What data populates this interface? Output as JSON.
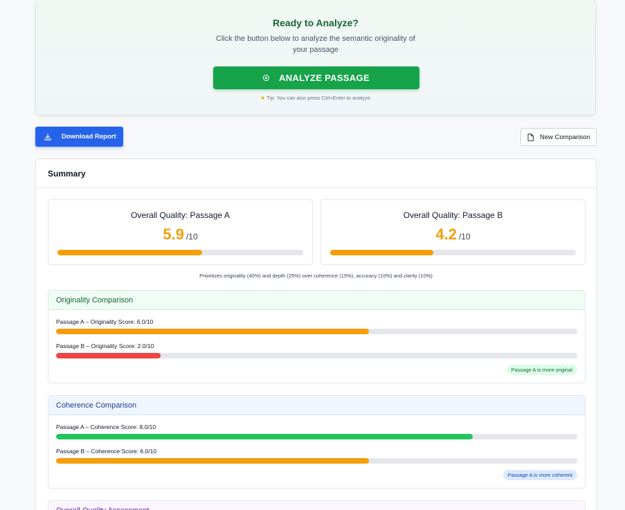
{
  "analyze": {
    "title": "Ready to Analyze?",
    "subtitle_line1": "Click the button below to analyze the semantic originality of",
    "subtitle_line2": "your passage",
    "button_label": "ANALYZE PASSAGE",
    "button_icon": "target-icon",
    "tip": "Tip: You can also press Ctrl+Enter to analyze",
    "tip_icon": "lightbulb-icon"
  },
  "actions": {
    "download_label": "Download Report",
    "download_icon": "download-icon",
    "new_label": "New Comparison",
    "new_icon": "document-icon"
  },
  "summary": {
    "title": "Summary",
    "passage_a": {
      "title": "Overall Quality: Passage A",
      "score": "5.9",
      "denominator": "/10",
      "fraction": 0.59,
      "color": "#f59e0b"
    },
    "passage_b": {
      "title": "Overall Quality: Passage B",
      "score": "4.2",
      "denominator": "/10",
      "fraction": 0.42,
      "color": "#f59e0b"
    },
    "weights_note": "Prioritizes originality (40%) and depth (25%) over coherence (15%), accuracy (10%) and clarity (10%)",
    "originality": {
      "title": "Originality Comparison",
      "row_a": {
        "label": "Passage A – Originality Score: 6.0/10",
        "fraction": 0.6,
        "color": "#f59e0b"
      },
      "row_b": {
        "label": "Passage B – Originality Score: 2.0/10",
        "fraction": 0.2,
        "color": "#ef4444"
      },
      "verdict": "Passage A is more original"
    },
    "coherence": {
      "title": "Coherence Comparison",
      "row_a": {
        "label": "Passage A – Coherence Score: 8.0/10",
        "fraction": 0.8,
        "color": "#22c55e"
      },
      "row_b": {
        "label": "Passage B – Coherence Score: 6.0/10",
        "fraction": 0.6,
        "color": "#f59e0b"
      },
      "verdict": "Passage A is more coherent"
    },
    "overall": {
      "title": "Overall Quality Assessment"
    }
  }
}
